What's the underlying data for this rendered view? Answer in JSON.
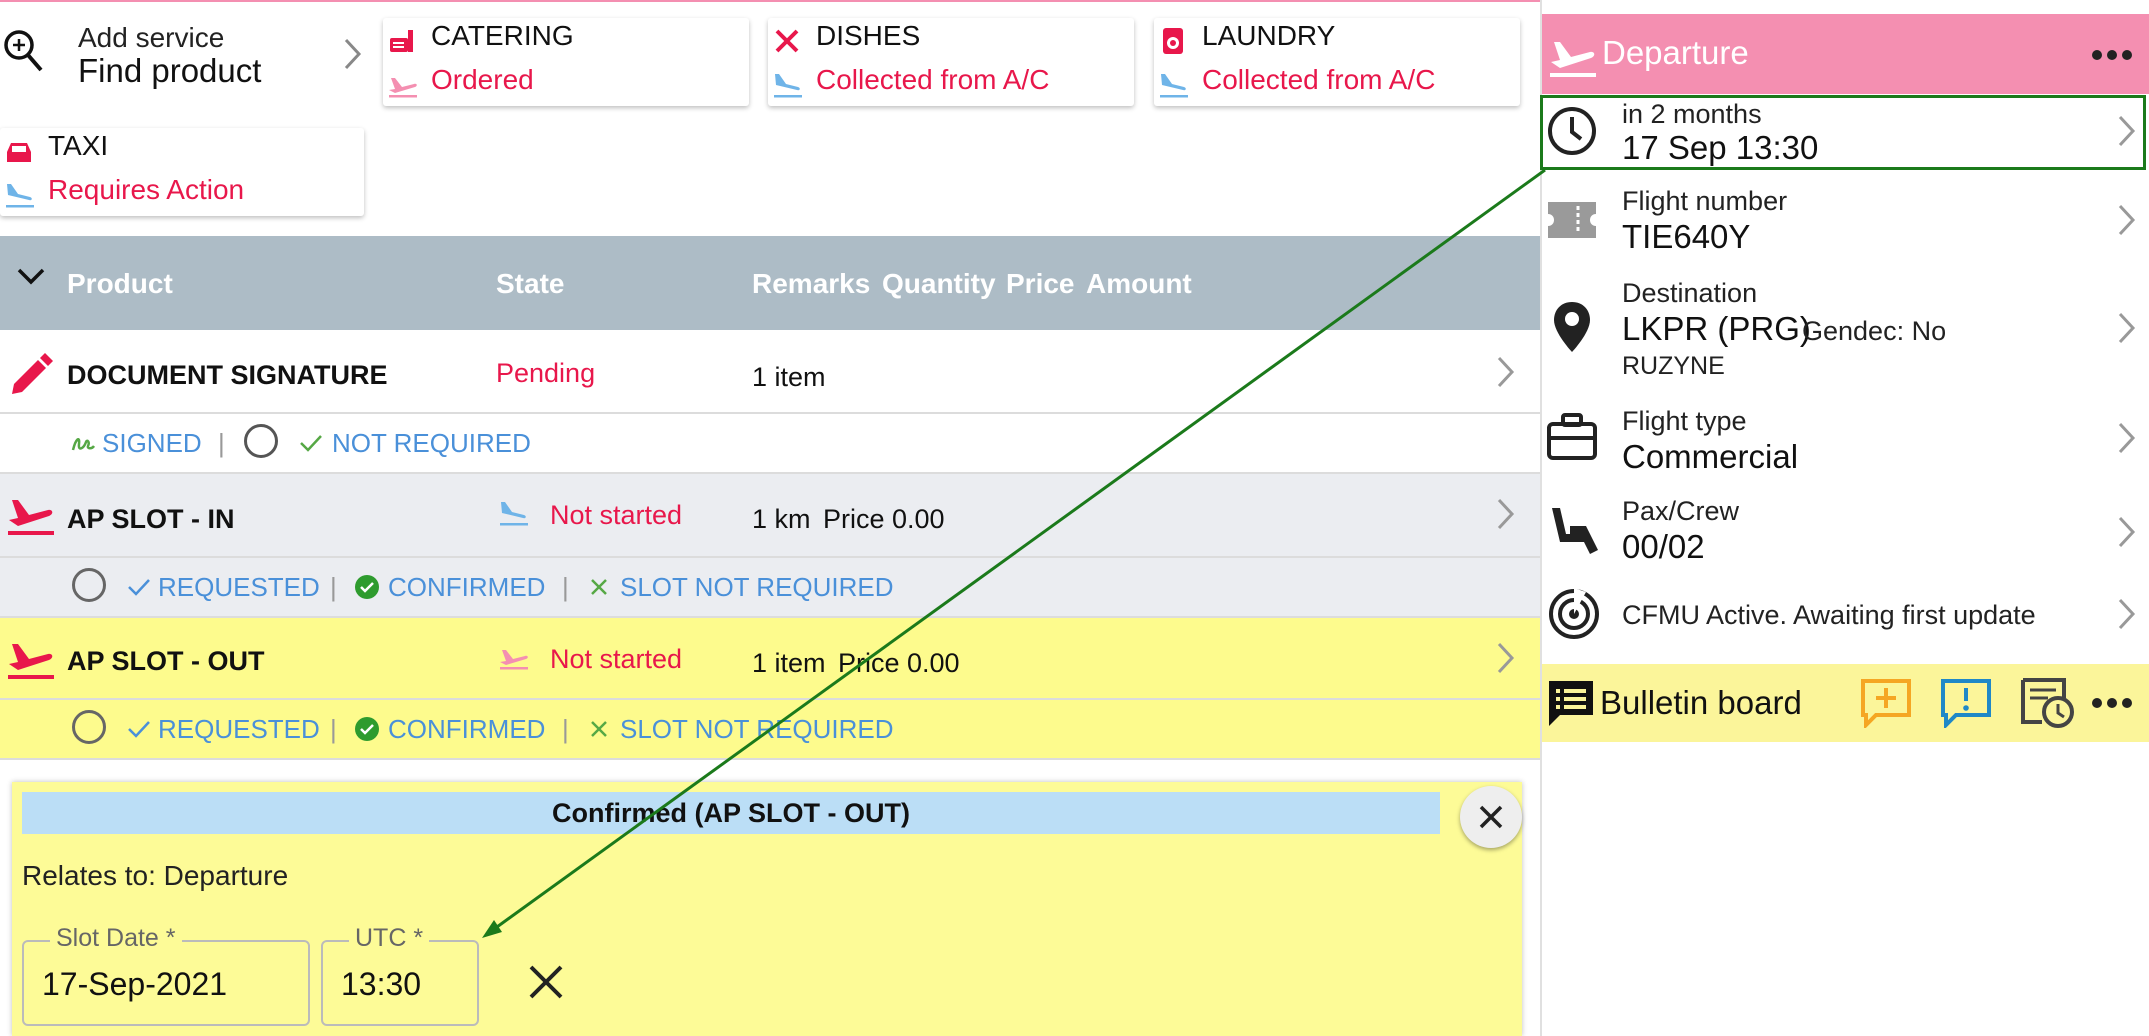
{
  "service": {
    "add_label": "Add service",
    "find_label": "Find product"
  },
  "cards": [
    {
      "title": "CATERING",
      "status": "Ordered"
    },
    {
      "title": "DISHES",
      "status": "Collected from A/C"
    },
    {
      "title": "LAUNDRY",
      "status": "Collected from A/C"
    },
    {
      "title": "TAXI",
      "status": "Requires Action"
    }
  ],
  "table": {
    "headers": {
      "product": "Product",
      "state": "State",
      "remarks": "Remarks",
      "quantity": "Quantity",
      "price": "Price",
      "amount": "Amount"
    },
    "rows": [
      {
        "name": "DOCUMENT SIGNATURE",
        "state": "Pending",
        "remarks": "1 item",
        "sub": {
          "signed": "SIGNED",
          "sep": "|",
          "not_required": "NOT REQUIRED"
        }
      },
      {
        "name": "AP SLOT - IN",
        "state": "Not started",
        "remarks": "1 km",
        "price": "Price 0.00",
        "sub": {
          "requested": "REQUESTED",
          "sep": "|",
          "confirmed": "CONFIRMED",
          "slot_not_required": "SLOT NOT REQUIRED"
        }
      },
      {
        "name": "AP SLOT - OUT",
        "state": "Not started",
        "remarks": "1 item",
        "price": "Price 0.00",
        "sub": {
          "requested": "REQUESTED",
          "sep": "|",
          "confirmed": "CONFIRMED",
          "slot_not_required": "SLOT NOT REQUIRED"
        }
      }
    ]
  },
  "dialog": {
    "title": "Confirmed (AP SLOT - OUT)",
    "relates": "Relates to: Departure",
    "slot_date_label": "Slot Date *",
    "slot_date_value": "17-Sep-2021",
    "utc_label": "UTC *",
    "utc_value": "13:30"
  },
  "panel": {
    "title": "Departure",
    "items": [
      {
        "label": "in 2 months",
        "value": "17 Sep 13:30"
      },
      {
        "label": "Flight number",
        "value": "TIE640Y"
      },
      {
        "label": "Destination",
        "value": "LKPR (PRG)",
        "extra": "Gendec: No",
        "sub": "RUZYNE"
      },
      {
        "label": "Flight type",
        "value": "Commercial"
      },
      {
        "label": "Pax/Crew",
        "value": "00/02"
      },
      {
        "label": "CFMU Active. Awaiting first update"
      }
    ],
    "bulletin_title": "Bulletin board"
  },
  "colors": {
    "accent_pink": "#f48fb1",
    "alert_red": "#e8174b",
    "link_blue": "#4a90d9",
    "highlight_yellow": "#fdfb97",
    "header_gray": "#adbcc6",
    "annotation_green": "#1b7a1b"
  }
}
